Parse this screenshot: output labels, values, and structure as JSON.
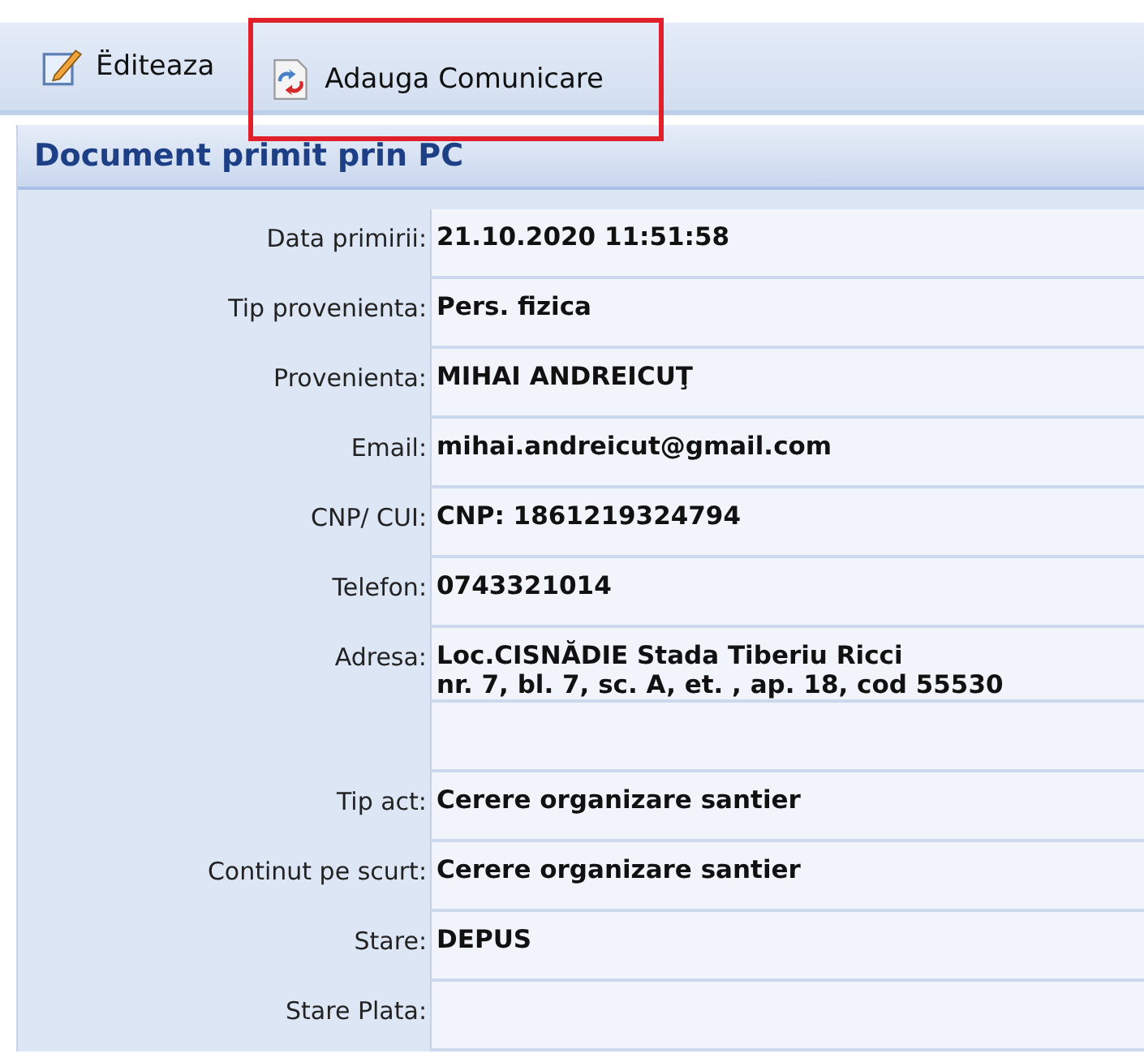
{
  "toolbar": {
    "buttons": [
      {
        "label": "Ëditeaza",
        "kind": "edit",
        "highlighted": false
      },
      {
        "label": "Adauga Comunicare",
        "kind": "document",
        "highlighted": true
      }
    ]
  },
  "panel": {
    "title": "Document primit prin PC"
  },
  "fields": [
    {
      "label": "Data primirii:",
      "value": [
        "21.10.2020 11:51:58"
      ]
    },
    {
      "label": "Tip provenienta:",
      "value": [
        "Pers. fizica"
      ]
    },
    {
      "label": "Provenienta:",
      "value": [
        "MIHAI ANDREICUŢ"
      ]
    },
    {
      "label": "Email:",
      "value": [
        "mihai.andreicut@gmail.com"
      ]
    },
    {
      "label": "CNP/ CUI:",
      "value": [
        "CNP: 1861219324794"
      ]
    },
    {
      "label": "Telefon:",
      "value": [
        "0743321014"
      ]
    },
    {
      "label": "Adresa:",
      "value": [
        "Loc.CISNĂDIE Stada Tiberiu Ricci",
        "nr. 7, bl. 7, sc. A, et. , ap. 18, cod 55530"
      ]
    },
    {
      "kind": "blank"
    },
    {
      "label": "Tip act:",
      "value": [
        "Cerere organizare santier"
      ]
    },
    {
      "label": "Continut pe scurt:",
      "value": [
        "Cerere organizare santier"
      ]
    },
    {
      "label": "Stare:",
      "value": [
        "DEPUS"
      ]
    },
    {
      "label": "Stare Plata:"
    }
  ]
}
